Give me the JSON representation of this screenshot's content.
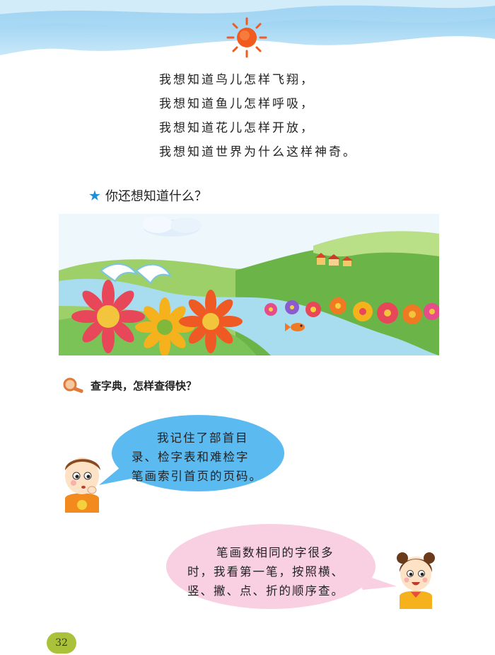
{
  "poem": {
    "lines": [
      "我想知道鸟儿怎样飞翔，",
      "我想知道鱼儿怎样呼吸，",
      "我想知道花儿怎样开放，",
      "我想知道世界为什么这样神奇。"
    ]
  },
  "question": {
    "icon": "star-icon",
    "text": "你还想知道什么？"
  },
  "tip": {
    "icon": "magnifier-icon",
    "text": "查字典，怎样查得快？"
  },
  "bubbles": [
    {
      "speaker": "boy",
      "color": "#5bbaf0",
      "lines": [
        "我记住了部首目",
        "录、检字表和难检字",
        "笔画索引首页的页码。"
      ]
    },
    {
      "speaker": "girl",
      "color": "#f8d0e2",
      "lines": [
        "笔画数相同的字很多",
        "时，我看第一笔，按照横、",
        "竖、撇、点、折的顺序查。"
      ]
    }
  ],
  "page_number": "32",
  "colors": {
    "sky_wave": "#9fd3f0",
    "sun": "#f25a1e",
    "page_badge": "#a9c23a"
  }
}
